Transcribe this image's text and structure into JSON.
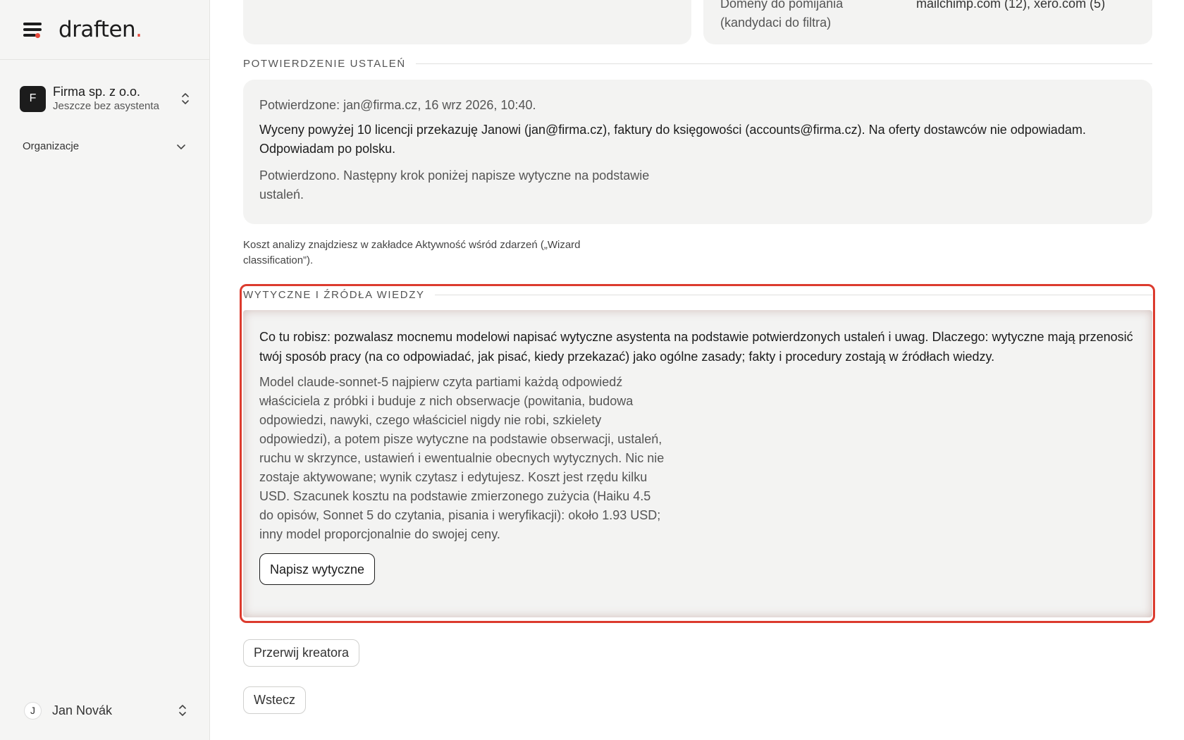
{
  "app": {
    "logo_text": "draften",
    "logo_dot": ".",
    "accent_color": "#e5483b"
  },
  "sidebar": {
    "org": {
      "initial": "F",
      "name": "Firma sp. z o.o.",
      "subtitle": "Jeszcze bez asystenta"
    },
    "section_label": "Organizacje",
    "user": {
      "initial": "J",
      "name": "Jan Novák"
    }
  },
  "main": {
    "top_card": {
      "key": "Domeny do pomijania (kandydaci do filtra)",
      "value": "mailchimp.com (12), xero.com (5)"
    },
    "confirmation": {
      "section_title": "POTWIERDZENIE USTALEŃ",
      "meta": "Potwierdzone: jan@firma.cz, 16 wrz 2026, 10:40.",
      "text": "Wyceny powyżej 10 licencji przekazuję Janowi (jan@firma.cz), faktury do księgowości (accounts@firma.cz). Na oferty dostawców nie odpowiadam. Odpowiadam po polsku.",
      "next_step": "Potwierdzono. Następny krok poniżej napisze wytyczne na podstawie ustaleń."
    },
    "cost_note": "Koszt analizy znajdziesz w zakładce Aktywność wśród zdarzeń („Wizard classification”).",
    "guidelines": {
      "section_title": "WYTYCZNE I ŹRÓDŁA WIEDZY",
      "lead": "Co tu robisz: pozwalasz mocnemu modelowi napisać wytyczne asystenta na podstawie potwierdzonych ustaleń i uwag. Dlaczego: wytyczne mają przenosić twój sposób pracy (na co odpowiadać, jak pisać, kiedy przekazać) jako ogólne zasady; fakty i procedury zostają w źródłach wiedzy.",
      "body": "Model claude-sonnet-5 najpierw czyta partiami każdą odpowiedź właściciela z próbki i buduje z nich obserwacje (powitania, budowa odpowiedzi, nawyki, czego właściciel nigdy nie robi, szkielety odpowiedzi), a potem pisze wytyczne na podstawie obserwacji, ustaleń, ruchu w skrzynce, ustawień i ewentualnie obecnych wytycznych. Nic nie zostaje aktywowane; wynik czytasz i edytujesz. Koszt jest rzędu kilku USD. Szacunek kosztu na podstawie zmierzonego zużycia (Haiku 4.5 do opisów, Sonnet 5 do czytania, pisania i weryfikacji): około 1.93 USD; inny model proporcjonalnie do swojej ceny.",
      "write_button": "Napisz wytyczne"
    },
    "abort_button": "Przerwij kreatora",
    "back_button": "Wstecz"
  }
}
